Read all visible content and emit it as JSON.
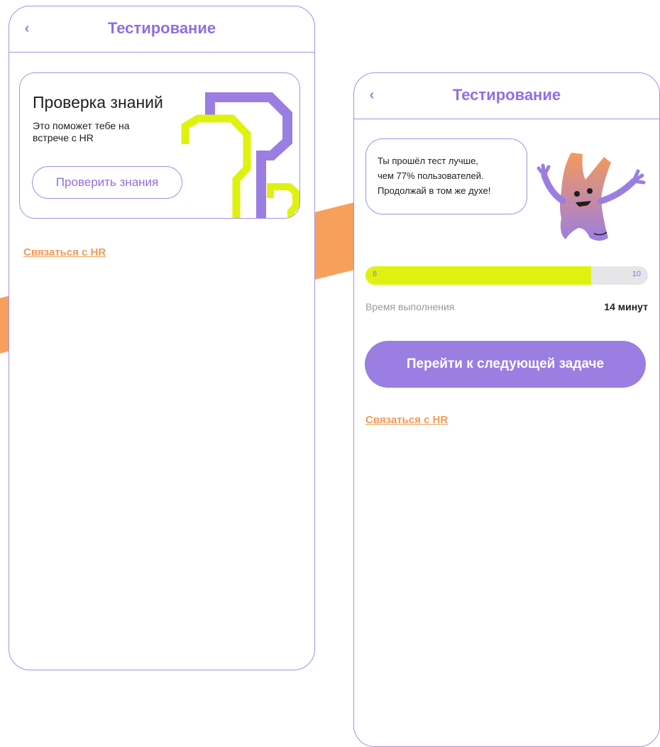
{
  "colors": {
    "accent_purple": "#9b7ee2",
    "accent_lime": "#dff20f",
    "accent_orange": "#f49a55",
    "text_dark": "#1e1e1e"
  },
  "screen_left": {
    "header": {
      "back_icon": "chevron-left-icon",
      "title": "Тестирование"
    },
    "card": {
      "title": "Проверка знаний",
      "text": "Это поможет тебе на встрече с HR",
      "button": "Проверить знания"
    },
    "contact_link": "Связаться с HR"
  },
  "screen_right": {
    "header": {
      "back_icon": "chevron-left-icon",
      "title": "Тестирование"
    },
    "bubble": {
      "line1": "Ты прошёл тест лучше,",
      "line2": "чем 77% пользователей.",
      "line3": "Продолжай в том же духе!"
    },
    "progress": {
      "current": "8",
      "total": "10",
      "fraction": 0.8
    },
    "time": {
      "label": "Время выполнения",
      "value": "14 минут"
    },
    "next_button": "Перейти к следующей задаче",
    "contact_link": "Связаться с HR"
  }
}
